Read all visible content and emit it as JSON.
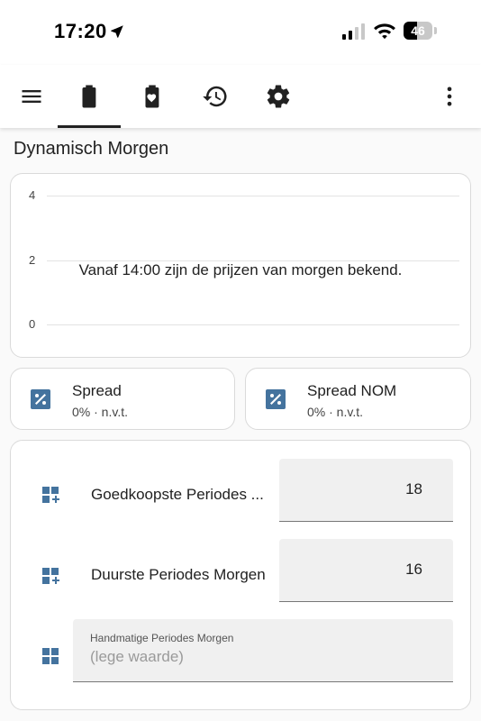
{
  "status_bar": {
    "time": "17:20",
    "battery": "46",
    "battery_level": 0.46
  },
  "toolbar": {
    "icons": [
      "menu-icon",
      "battery-icon",
      "battery-heart-icon",
      "history-icon",
      "gear-icon",
      "more-vert-icon"
    ],
    "active_tab": "battery-icon"
  },
  "page_title": "Dynamisch Morgen",
  "chart": {
    "y_ticks": [
      "4",
      "2",
      "0"
    ],
    "message": "Vanaf 14:00 zijn de prijzen van morgen bekend."
  },
  "chart_data": {
    "type": "line",
    "x": [],
    "series": [],
    "ylim": [
      0,
      4
    ],
    "grid": true,
    "annotations": [
      "Vanaf 14:00 zijn de prijzen van morgen bekend."
    ]
  },
  "tiles": [
    {
      "name": "Spread",
      "state": "0% · n.v.t.",
      "icon": "percent-box-icon"
    },
    {
      "name": "Spread NOM",
      "state": "0% · n.v.t.",
      "icon": "percent-box-icon"
    }
  ],
  "entities": [
    {
      "label": "Goedkoopste Periodes ...",
      "value": "18",
      "icon": "view-grid-plus-icon"
    },
    {
      "label": "Duurste Periodes Morgen",
      "value": "16",
      "icon": "view-grid-plus-icon"
    },
    {
      "label": "Handmatige Periodes Morgen",
      "placeholder": "(lege waarde)",
      "icon": "view-grid-icon"
    }
  ],
  "colors": {
    "accent": "#44739e",
    "text": "#212121"
  }
}
